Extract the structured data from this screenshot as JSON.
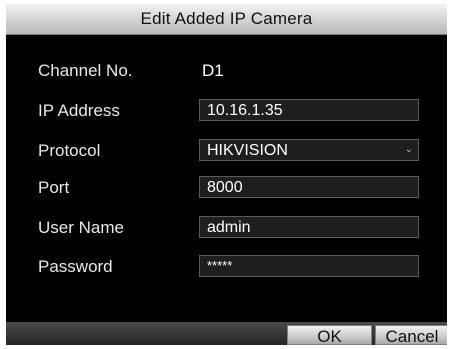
{
  "dialog": {
    "title": "Edit Added IP Camera"
  },
  "fields": {
    "channel": {
      "label": "Channel No.",
      "value": "D1"
    },
    "ip": {
      "label": "IP Address",
      "value": "10.16.1.35"
    },
    "protocol": {
      "label": "Protocol",
      "value": "HIKVISION",
      "icon": "chevron-down-icon"
    },
    "port": {
      "label": "Port",
      "value": "8000"
    },
    "username": {
      "label": "User Name",
      "value": "admin"
    },
    "password": {
      "label": "Password",
      "value": "*****"
    }
  },
  "buttons": {
    "ok": "OK",
    "cancel": "Cancel"
  }
}
